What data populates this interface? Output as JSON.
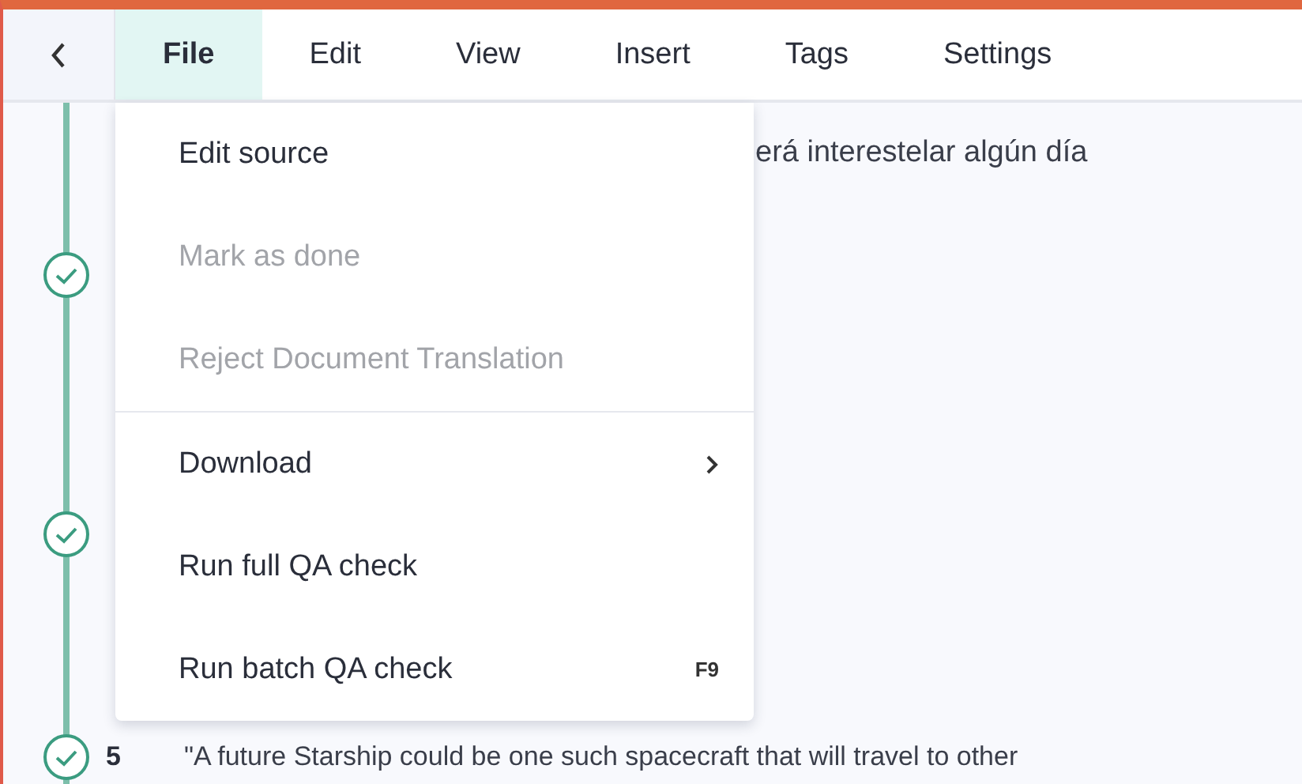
{
  "toolbar": {
    "tabs": [
      {
        "label": "File",
        "selected": true
      },
      {
        "label": "Edit",
        "selected": false
      },
      {
        "label": "View",
        "selected": false
      },
      {
        "label": "Insert",
        "selected": false
      },
      {
        "label": "Tags",
        "selected": false
      },
      {
        "label": "Settings",
        "selected": false
      }
    ]
  },
  "timeline": [
    {
      "text": "erá interestelar algún día",
      "done": false
    },
    {
      "done": true
    },
    {
      "done": true
    },
    {
      "number": "5",
      "text": "\"A future Starship could be one such spacecraft that will travel to other",
      "done": true
    }
  ],
  "menu": {
    "groups": [
      [
        {
          "label": "Edit source",
          "disabled": false
        },
        {
          "label": "Mark as done",
          "disabled": true
        },
        {
          "label": "Reject Document Translation",
          "disabled": true
        }
      ],
      [
        {
          "label": "Download",
          "disabled": false,
          "submenu": true
        },
        {
          "label": "Run full QA check",
          "disabled": false
        },
        {
          "label": "Run batch QA check",
          "disabled": false,
          "shortcut": "F9"
        }
      ]
    ]
  }
}
